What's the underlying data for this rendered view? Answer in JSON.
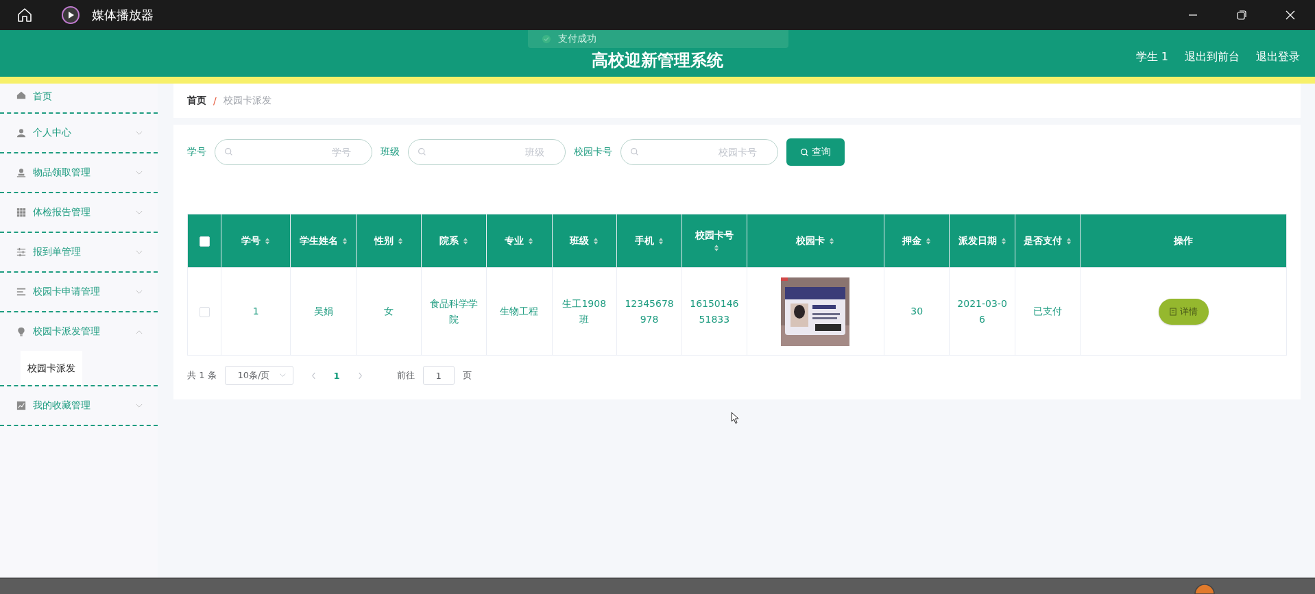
{
  "window": {
    "title": "媒体播放器"
  },
  "toast": {
    "text": "支付成功"
  },
  "header": {
    "title": "高校迎新管理系统",
    "links": [
      "学生 1",
      "退出到前台",
      "退出登录"
    ]
  },
  "sidebar": {
    "items": [
      {
        "kind": "link",
        "label": "首页"
      },
      {
        "kind": "menu",
        "label": "个人中心",
        "expanded": false
      },
      {
        "kind": "menu",
        "label": "物品领取管理",
        "expanded": false
      },
      {
        "kind": "menu",
        "label": "体检报告管理",
        "expanded": false
      },
      {
        "kind": "menu",
        "label": "报到单管理",
        "expanded": false
      },
      {
        "kind": "menu",
        "label": "校园卡申请管理",
        "expanded": false
      },
      {
        "kind": "menu",
        "label": "校园卡派发管理",
        "expanded": true,
        "children": [
          {
            "label": "校园卡派发",
            "selected": true
          }
        ]
      },
      {
        "kind": "menu",
        "label": "我的收藏管理",
        "expanded": false
      }
    ]
  },
  "breadcrumb": {
    "separator": "/",
    "items": [
      "首页",
      "校园卡派发"
    ]
  },
  "search": {
    "fields": [
      {
        "label": "学号",
        "placeholder": "学号"
      },
      {
        "label": "班级",
        "placeholder": "班级"
      },
      {
        "label": "校园卡号",
        "placeholder": "校园卡号"
      }
    ],
    "button": "查询"
  },
  "table": {
    "select_all": {
      "checked": false
    },
    "columns": [
      {
        "label": "学号",
        "sortable": true
      },
      {
        "label": "学生姓名",
        "sortable": true
      },
      {
        "label": "性别",
        "sortable": true
      },
      {
        "label": "院系",
        "sortable": true
      },
      {
        "label": "专业",
        "sortable": true
      },
      {
        "label": "班级",
        "sortable": true
      },
      {
        "label": "手机",
        "sortable": true
      },
      {
        "label": "校园卡号",
        "sortable": true
      },
      {
        "label": "校园卡",
        "sortable": true
      },
      {
        "label": "押金",
        "sortable": true
      },
      {
        "label": "派发日期",
        "sortable": true
      },
      {
        "label": "是否支付",
        "sortable": true
      },
      {
        "label": "操作",
        "sortable": false
      }
    ],
    "rows": [
      {
        "checked": false,
        "cells": [
          {
            "kind": "text",
            "text": "1"
          },
          {
            "kind": "text",
            "text": "吴娟"
          },
          {
            "kind": "text",
            "text": "女"
          },
          {
            "kind": "text",
            "text": "食品科学学院"
          },
          {
            "kind": "text",
            "text": "生物工程"
          },
          {
            "kind": "text",
            "text": "生工1908班"
          },
          {
            "kind": "text",
            "text": "12345678978"
          },
          {
            "kind": "text",
            "text": "1615014651833"
          },
          {
            "kind": "picture"
          },
          {
            "kind": "text",
            "text": "30"
          },
          {
            "kind": "text",
            "text": "2021-03-06"
          },
          {
            "kind": "text",
            "text": "已支付"
          },
          {
            "kind": "button",
            "text": "详情"
          }
        ]
      }
    ]
  },
  "pagination": {
    "total": "共 1 条",
    "page_size": "10条/页",
    "pages": [
      {
        "label": "1",
        "selected": true
      }
    ],
    "goto_label": "前往",
    "goto_value": "1",
    "goto_suffix": "页"
  }
}
